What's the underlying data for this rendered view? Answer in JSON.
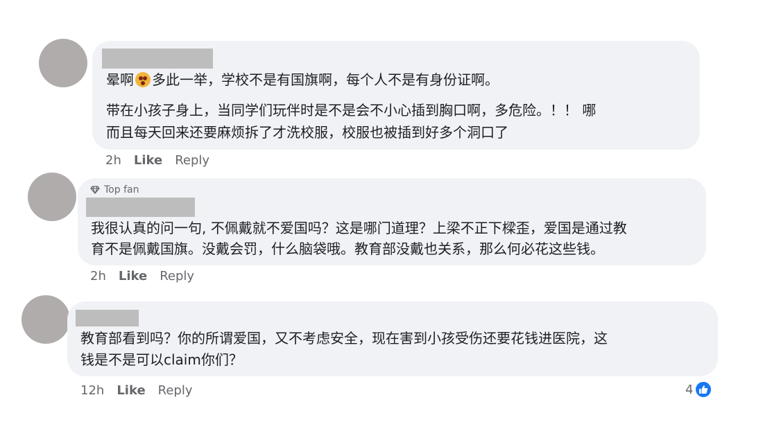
{
  "comments": [
    {
      "badge": null,
      "paragraphs": [
        {
          "before_emoji": "晕啊",
          "emoji": "astonished-face-emoji",
          "after_emoji": "多此一举，学校不是有国旗啊，每个人不是有身份证啊。"
        },
        {
          "line1": "带在小孩子身上，当同学们玩伴时是不是会不小心插到胸口啊，多危险。！！ 哪",
          "line2": "而且每天回来还要麻烦拆了才洗校服，校服也被插到好多个洞口了"
        }
      ],
      "time": "2h",
      "like_label": "Like",
      "reply_label": "Reply"
    },
    {
      "badge": "Top fan",
      "line1": "我很认真的问一句, 不佩戴就不爱国吗？这是哪门道理？上梁不正下樑歪，爱国是通过教",
      "line2": "育不是佩戴国旗。没戴会罚，什么脑袋哦。教育部没戴也关系，那么何必花这些钱。",
      "time": "2h",
      "like_label": "Like",
      "reply_label": "Reply"
    },
    {
      "badge": null,
      "line1": "教育部看到吗？你的所谓爱国，又不考虑安全，现在害到小孩受伤还要花钱进医院，这",
      "line2": "钱是不是可以claim你们？",
      "time": "12h",
      "like_label": "Like",
      "reply_label": "Reply",
      "reaction_count": "4",
      "reaction_icon": "thumbs-up-icon",
      "colors": {
        "like_blue": "#1877f2"
      }
    }
  ]
}
